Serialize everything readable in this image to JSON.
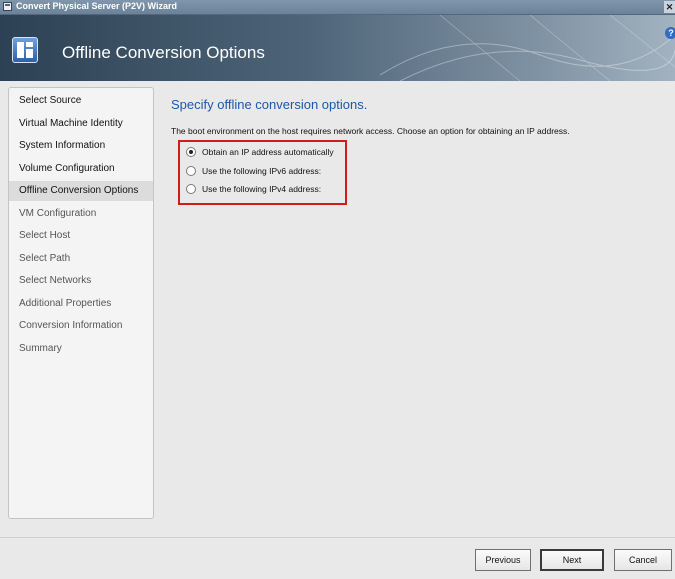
{
  "window": {
    "title": "Convert Physical Server (P2V) Wizard",
    "close_glyph": "✕"
  },
  "header": {
    "title": "Offline Conversion Options",
    "icon": "wizard-icon",
    "help_glyph": "?"
  },
  "nav": {
    "items": [
      {
        "label": "Select Source",
        "state": "done"
      },
      {
        "label": "Virtual Machine Identity",
        "state": "done"
      },
      {
        "label": "System Information",
        "state": "done"
      },
      {
        "label": "Volume Configuration",
        "state": "done"
      },
      {
        "label": "Offline Conversion Options",
        "state": "active"
      },
      {
        "label": "VM Configuration",
        "state": "future"
      },
      {
        "label": "Select Host",
        "state": "future"
      },
      {
        "label": "Select Path",
        "state": "future"
      },
      {
        "label": "Select Networks",
        "state": "future"
      },
      {
        "label": "Additional Properties",
        "state": "future"
      },
      {
        "label": "Conversion Information",
        "state": "future"
      },
      {
        "label": "Summary",
        "state": "future"
      }
    ]
  },
  "main": {
    "heading": "Specify offline conversion options.",
    "description": "The boot environment on the host requires network access. Choose an option for obtaining an IP address.",
    "options": [
      {
        "label": "Obtain an IP address automatically",
        "selected": true
      },
      {
        "label": "Use the following IPv6 address:",
        "selected": false
      },
      {
        "label": "Use the following IPv4 address:",
        "selected": false
      }
    ],
    "highlight_color": "#d11c1c"
  },
  "footer": {
    "previous_label": "Previous",
    "next_label": "Next",
    "cancel_label": "Cancel"
  }
}
